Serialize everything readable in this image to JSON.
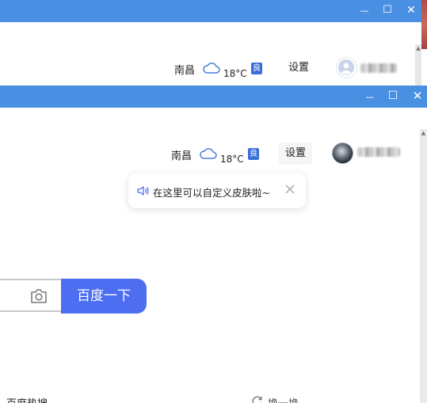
{
  "background_window": {
    "city": "南昌",
    "temperature": "18°C",
    "air_quality": "良",
    "settings_label": "设置",
    "window_controls": {
      "minimize": "—",
      "maximize": "☐",
      "close": "✕"
    }
  },
  "front_window": {
    "city": "南昌",
    "temperature": "18°C",
    "air_quality": "良",
    "settings_label": "设置",
    "window_controls": {
      "minimize": "—",
      "maximize": "☐",
      "close": "✕"
    },
    "tooltip": {
      "text": "在这里可以自定义皮肤啦~"
    },
    "search": {
      "button_label": "百度一下"
    },
    "hot_search": {
      "title": "百度热搜",
      "refresh_label": "换一换"
    }
  },
  "icons": {
    "weather": "cloud-icon",
    "speaker": "speaker-icon",
    "close": "close-icon",
    "camera": "camera-icon",
    "refresh": "refresh-icon"
  },
  "colors": {
    "titlebar": "#4a90e2",
    "search_button": "#4e6ef2",
    "air_quality_badge": "#3a6fd8"
  }
}
